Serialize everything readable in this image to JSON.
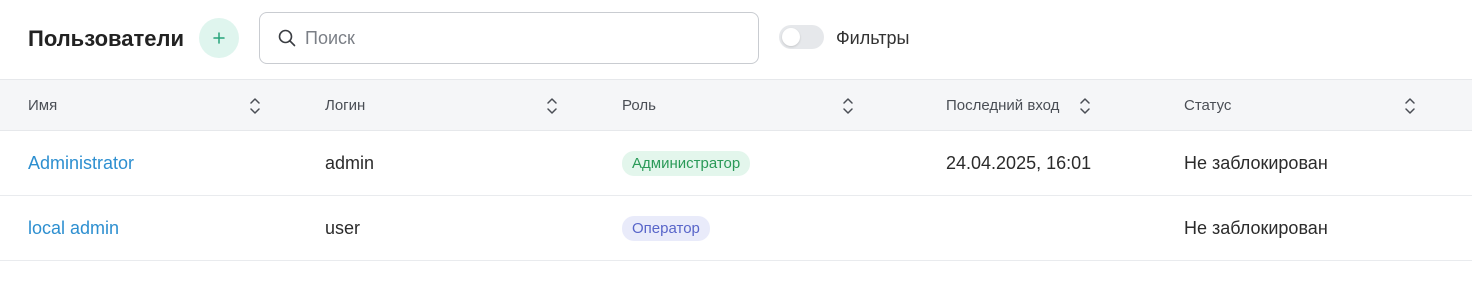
{
  "header": {
    "title": "Пользователи",
    "add_button_icon": "plus-icon",
    "search": {
      "placeholder": "Поиск",
      "value": ""
    },
    "filters": {
      "label": "Фильтры",
      "enabled": false
    }
  },
  "table": {
    "columns": [
      {
        "label": "Имя",
        "sortable": true
      },
      {
        "label": "Логин",
        "sortable": true
      },
      {
        "label": "Роль",
        "sortable": true
      },
      {
        "label": "Последний вход",
        "sortable": true
      },
      {
        "label": "Статус",
        "sortable": true
      }
    ],
    "rows": [
      {
        "name": "Administrator",
        "login": "admin",
        "role": "Администратор",
        "role_type": "admin",
        "last_login": "24.04.2025, 16:01",
        "status": "Не заблокирован"
      },
      {
        "name": "local admin",
        "login": "user",
        "role": "Оператор",
        "role_type": "operator",
        "last_login": "",
        "status": "Не заблокирован"
      }
    ]
  },
  "colors": {
    "accent_link": "#2d8fd0",
    "add_button_bg": "#dff5ee",
    "add_button_icon": "#27a37a",
    "admin_badge_bg": "#e3f6ec",
    "admin_badge_text": "#2a9a58",
    "operator_badge_bg": "#e9ebfa",
    "operator_badge_text": "#5865c9",
    "header_row_bg": "#f5f6f8"
  }
}
